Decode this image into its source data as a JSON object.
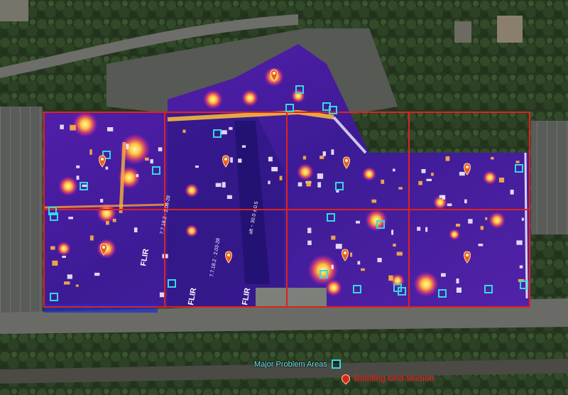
{
  "map": {
    "type": "aerial-thermal-roof-scan",
    "colors": {
      "grid_line": "#e0221b",
      "problem_area": "#35d8e4",
      "thermal_base": "#3b1a8a",
      "thermal_hot": "#ffd34a",
      "pin": "#e8601c",
      "legend_problem_text": "#6fe3ea",
      "legend_grid_text": "#e0221b"
    },
    "markers": {
      "icon": "location-pin-icon",
      "problem_icon": "square-outline-icon"
    },
    "roof_labels": {
      "watermark": "FLIR",
      "measure_1": "7.7.18.2 · 2.03-28",
      "measure_2": "aft ~ 30.0 ± 0.5"
    }
  },
  "legend": {
    "problem_areas_label": "Major Problem Areas",
    "grid_section_label": "Building Grid Section"
  }
}
